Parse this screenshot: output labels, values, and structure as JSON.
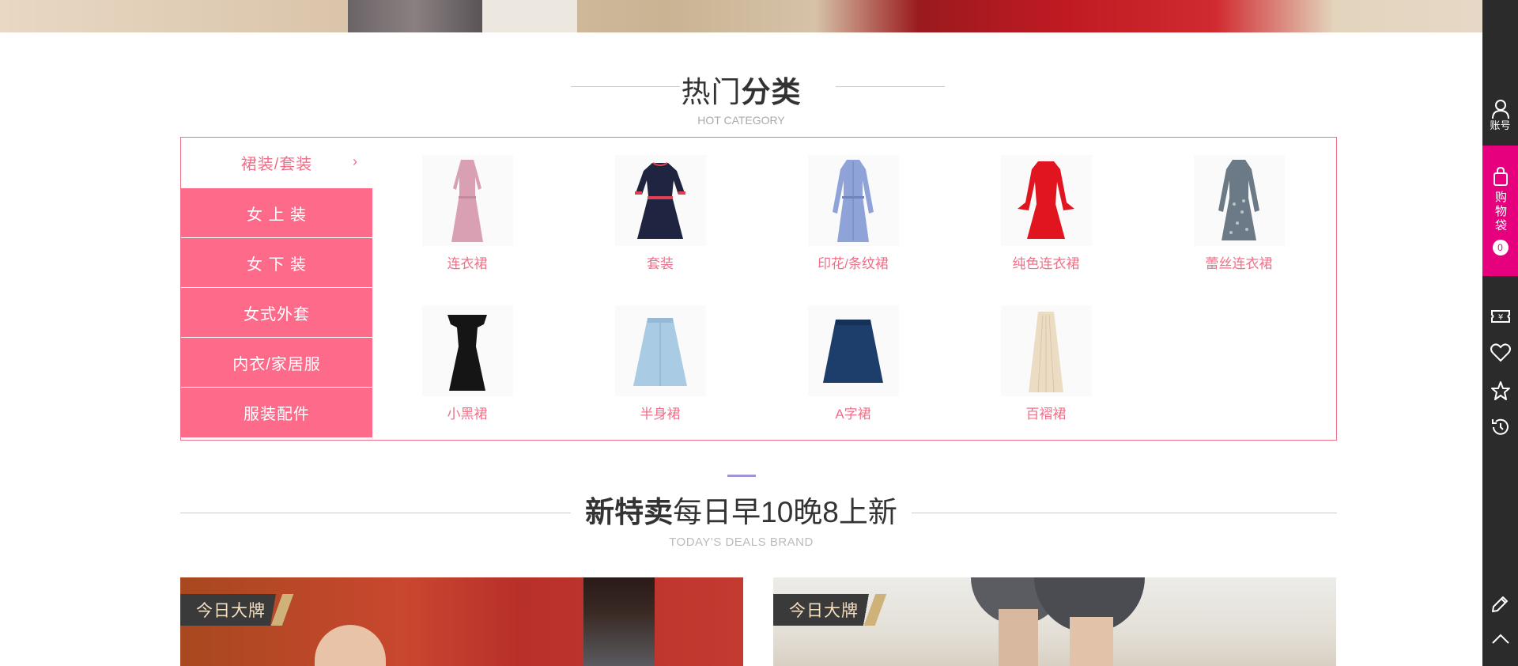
{
  "hot_category": {
    "title_light": "热门",
    "title_bold": "分类",
    "subtitle": "HOT CATEGORY",
    "menu": [
      {
        "label": "裙装/套装",
        "active": true
      },
      {
        "label": "女 上 装",
        "active": false
      },
      {
        "label": "女 下 装",
        "active": false
      },
      {
        "label": "女式外套",
        "active": false
      },
      {
        "label": "内衣/家居服",
        "active": false
      },
      {
        "label": "服装配件",
        "active": false
      }
    ],
    "products": [
      {
        "label": "连衣裙",
        "icon": "pink-dress-icon",
        "color": "#d9a0b4"
      },
      {
        "label": "套装",
        "icon": "navy-dress-icon",
        "color": "#1f2540"
      },
      {
        "label": "印花/条纹裙",
        "icon": "blue-shirt-dress-icon",
        "color": "#8fa3d8"
      },
      {
        "label": "纯色连衣裙",
        "icon": "red-dress-icon",
        "color": "#e0151f"
      },
      {
        "label": "蕾丝连衣裙",
        "icon": "lace-dress-icon",
        "color": "#6b7a86"
      },
      {
        "label": "小黑裙",
        "icon": "black-dress-icon",
        "color": "#151515"
      },
      {
        "label": "半身裙",
        "icon": "denim-skirt-icon",
        "color": "#a9cbe3"
      },
      {
        "label": "A字裙",
        "icon": "a-line-skirt-icon",
        "color": "#1d3d6b"
      },
      {
        "label": "百褶裙",
        "icon": "pleated-skirt-icon",
        "color": "#ecdcc4"
      }
    ]
  },
  "deals": {
    "title_bold": "新特卖",
    "title_light": "每日早10晚8上新",
    "subtitle": "TODAY'S DEALS BRAND",
    "cards": [
      {
        "tag": "今日大牌"
      },
      {
        "tag": "今日大牌"
      }
    ]
  },
  "sidebar": {
    "account_label": "账号",
    "cart_label": "购物袋",
    "cart_count": "0"
  },
  "colors": {
    "accent_pink": "#fe6a8a",
    "sidebar_bg": "#2b2b2b",
    "cart_magenta": "#e6007e"
  }
}
